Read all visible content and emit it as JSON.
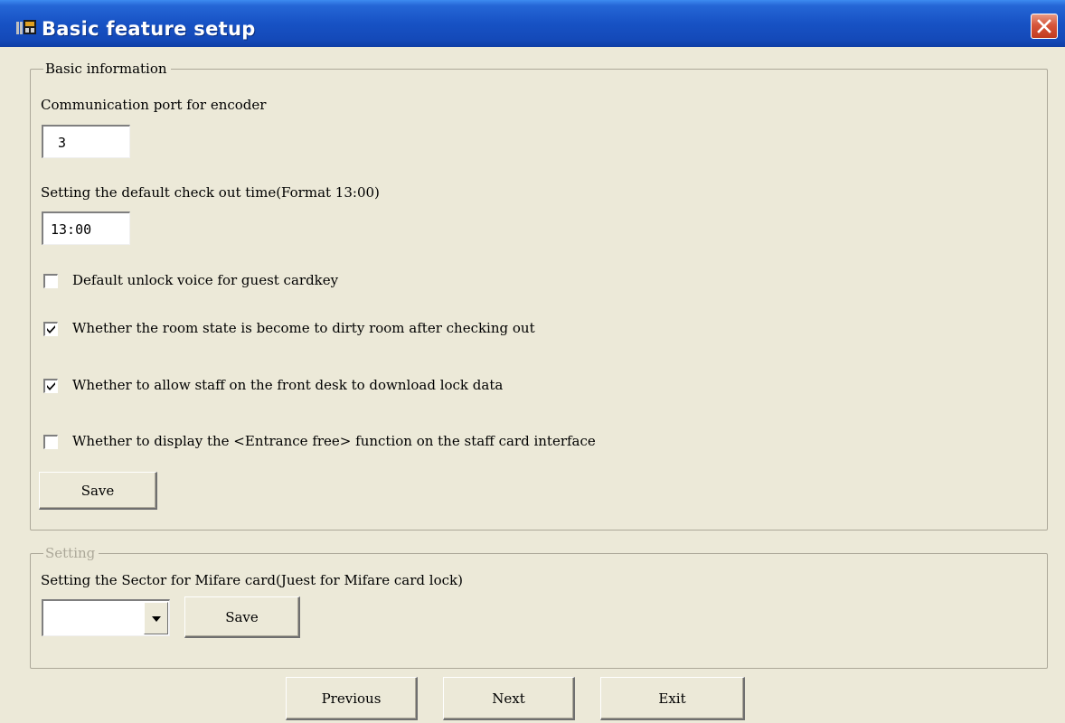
{
  "window": {
    "title": "Basic feature setup",
    "icons": {
      "app": "building-icon",
      "close": "close-icon"
    },
    "colors": {
      "titlebar": "#1752c4",
      "close": "#d6553a",
      "background": "#ece9d8"
    }
  },
  "basic_group": {
    "legend": "Basic information",
    "comm_port_label": "Communication port for encoder",
    "comm_port_value": "3",
    "checkout_label": "Setting the default check out time(Format 13:00)",
    "checkout_value": "13:00",
    "checkboxes": [
      {
        "label": "Default unlock voice for guest cardkey",
        "checked": false
      },
      {
        "label": "Whether the room state is become to dirty room after checking out",
        "checked": true
      },
      {
        "label": "Whether to allow staff on the front desk to download lock data",
        "checked": true
      },
      {
        "label": "Whether to display the <Entrance free> function on the staff card interface",
        "checked": false
      }
    ],
    "save_label": "Save"
  },
  "setting_group": {
    "legend": "Setting",
    "sector_label": "Setting the Sector for Mifare card(Juest for Mifare card lock)",
    "sector_value": "",
    "save_label": "Save"
  },
  "footer": {
    "previous_label": "Previous",
    "next_label": "Next",
    "exit_label": "Exit"
  }
}
